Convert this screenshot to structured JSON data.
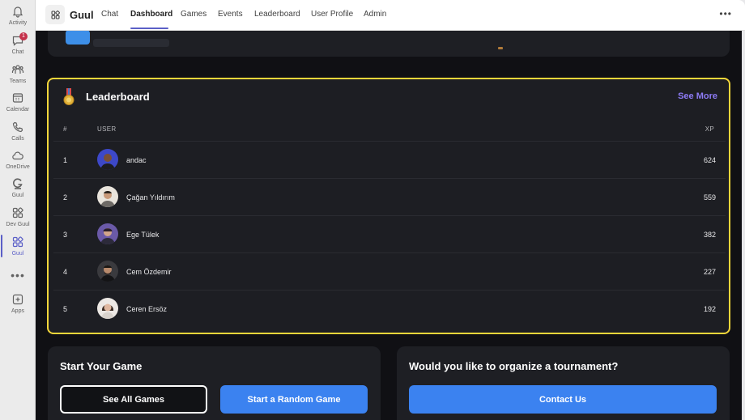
{
  "rail": {
    "items": [
      {
        "label": "Activity",
        "icon": "bell-icon"
      },
      {
        "label": "Chat",
        "icon": "chat-icon",
        "badge": "1"
      },
      {
        "label": "Teams",
        "icon": "teams-icon"
      },
      {
        "label": "Calendar",
        "icon": "calendar-icon"
      },
      {
        "label": "Calls",
        "icon": "phone-icon"
      },
      {
        "label": "OneDrive",
        "icon": "cloud-icon"
      },
      {
        "label": "Guul",
        "icon": "guul-logo-icon"
      },
      {
        "label": "Dev Guul",
        "icon": "apps-grid-icon"
      },
      {
        "label": "Guul",
        "icon": "apps-grid-icon"
      },
      {
        "label": "Apps",
        "icon": "add-app-icon"
      }
    ],
    "more": "•••"
  },
  "header": {
    "app_name": "Guul",
    "tabs": [
      "Chat",
      "Dashboard",
      "Games",
      "Events",
      "Leaderboard",
      "User Profile",
      "Admin"
    ],
    "active_tab": "Dashboard",
    "more": "•••"
  },
  "leaderboard": {
    "title": "Leaderboard",
    "see_more": "See More",
    "columns": {
      "rank": "#",
      "user": "USER",
      "xp": "XP"
    },
    "rows": [
      {
        "rank": "1",
        "name": "andac",
        "xp": "624"
      },
      {
        "rank": "2",
        "name": "Çağan Yıldırım",
        "xp": "559"
      },
      {
        "rank": "3",
        "name": "Ege Tülek",
        "xp": "382"
      },
      {
        "rank": "4",
        "name": "Cem Özdemir",
        "xp": "227"
      },
      {
        "rank": "5",
        "name": "Ceren Ersöz",
        "xp": "192"
      }
    ]
  },
  "start_game": {
    "title": "Start Your Game",
    "see_all_label": "See All Games",
    "random_label": "Start a Random Game"
  },
  "tournament": {
    "title": "Would you like to organize a tournament?",
    "contact_label": "Contact Us"
  },
  "colors": {
    "accent": "#5b5fc7",
    "highlight_border": "#f4d63a",
    "see_more": "#8d7bf5",
    "button_blue": "#3b82f0",
    "content_bg": "#101014",
    "card_bg": "#1e1f24"
  }
}
